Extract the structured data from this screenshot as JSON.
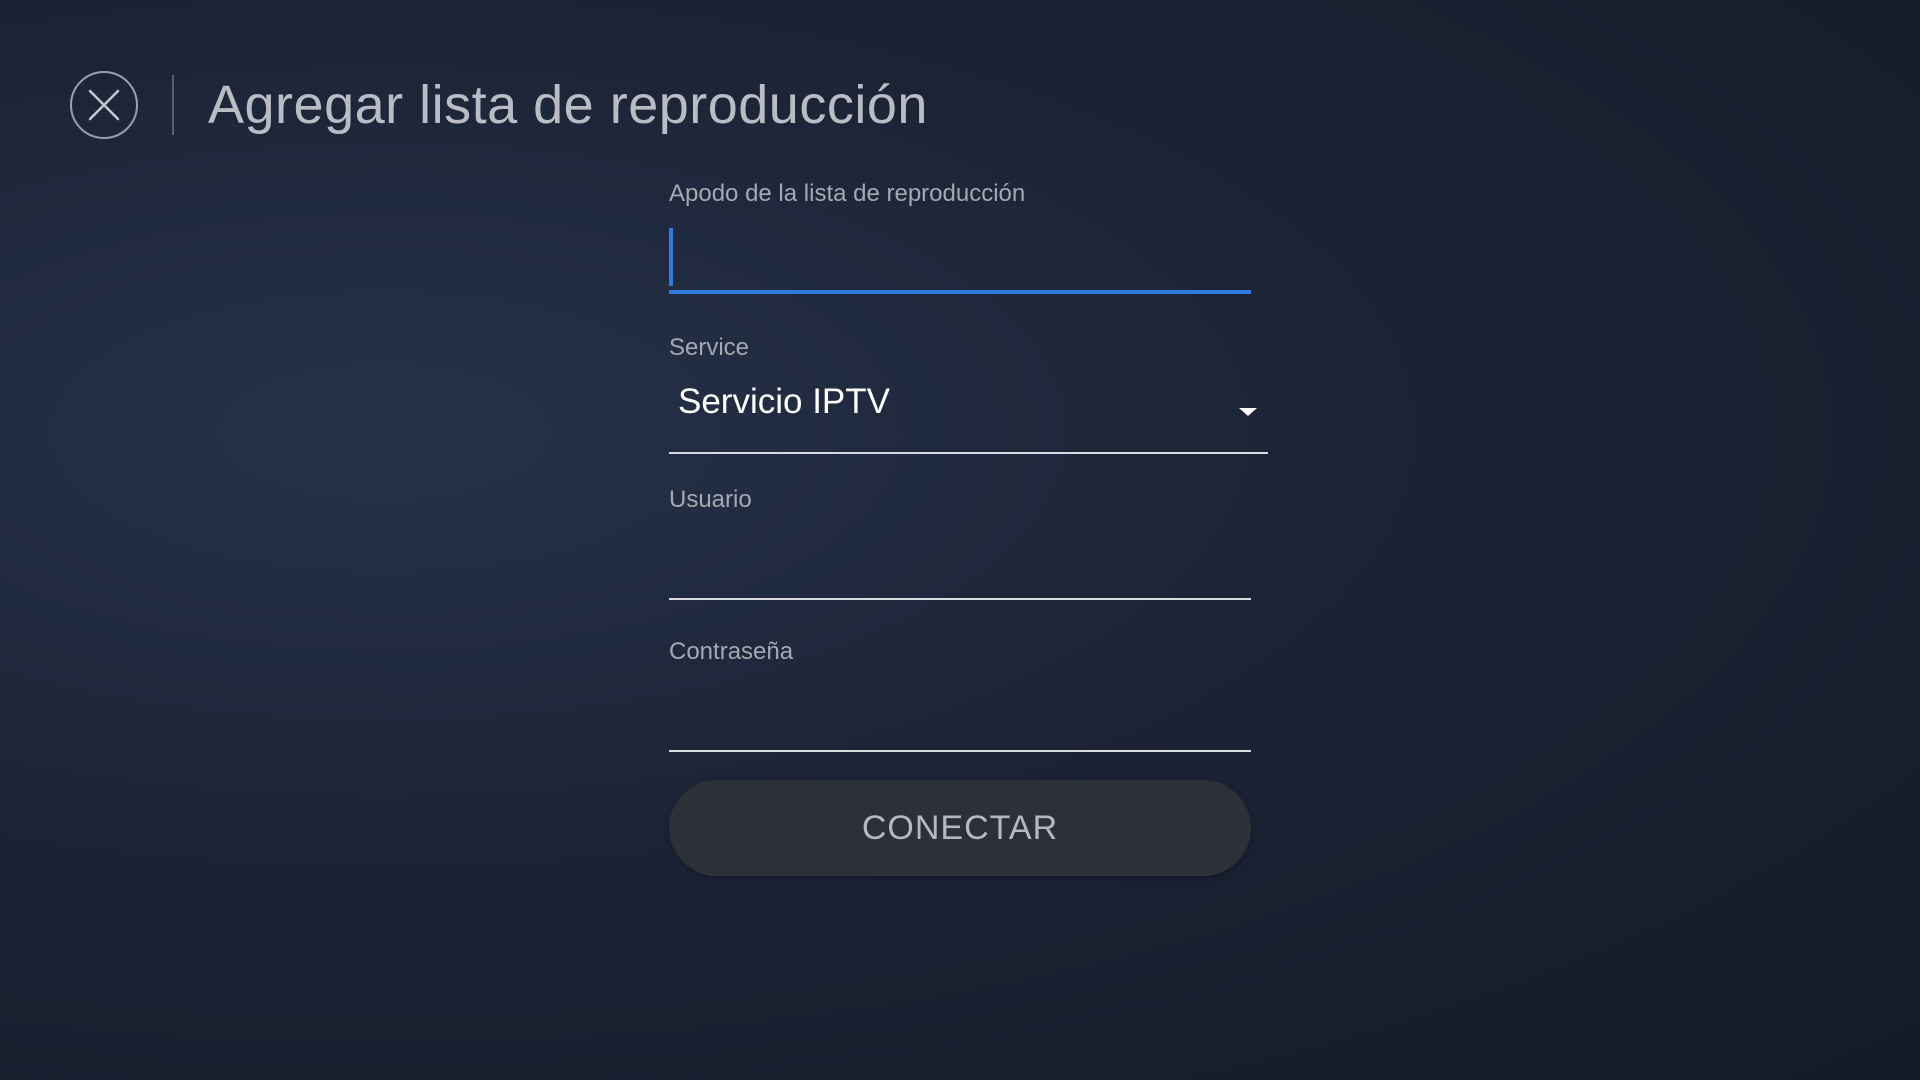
{
  "header": {
    "close_icon": "close-icon",
    "title": "Agregar lista de reproducción"
  },
  "form": {
    "nickname": {
      "label": "Apodo de la lista de reproducción",
      "value": "",
      "focused": true
    },
    "service": {
      "label": "Service",
      "selected": "Servicio IPTV",
      "icon": "chevron-down-icon"
    },
    "username": {
      "label": "Usuario",
      "value": ""
    },
    "password": {
      "label": "Contraseña",
      "value": ""
    },
    "connect_label": "CONECTAR"
  },
  "colors": {
    "accent": "#2f7be0",
    "background": "#1c2335",
    "button": "#2c3038"
  }
}
